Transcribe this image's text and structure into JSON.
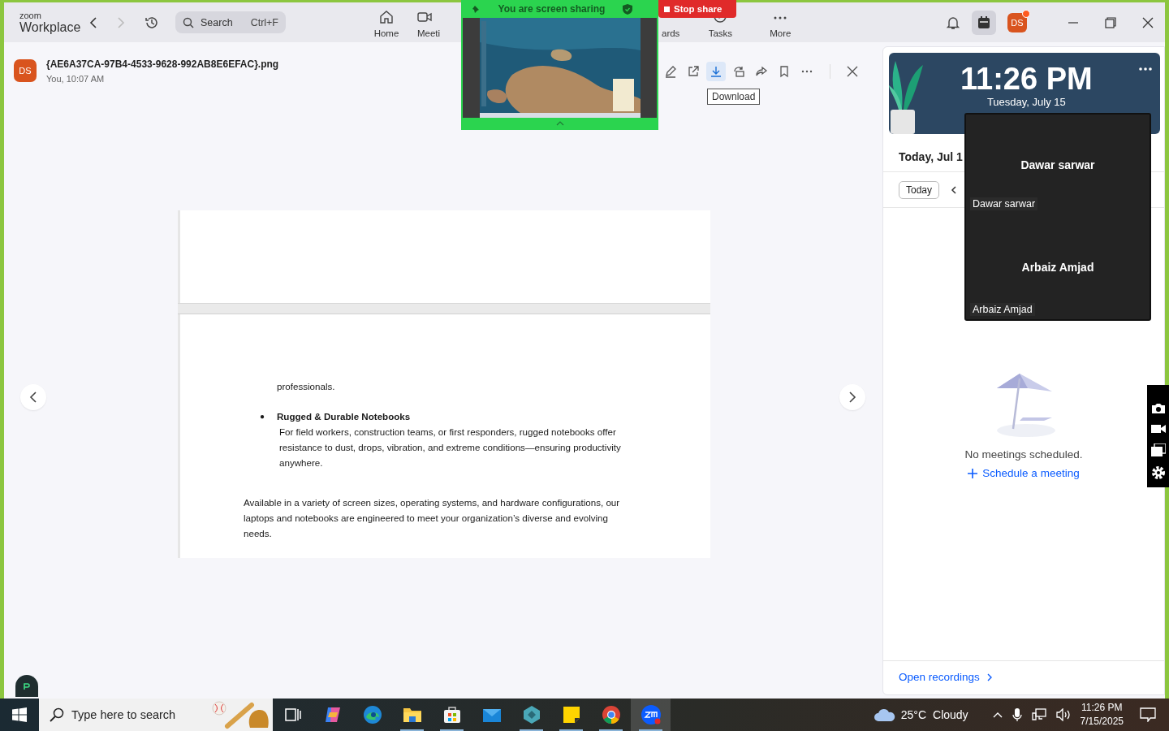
{
  "app": {
    "logo_top": "zoom",
    "logo_bottom": "Workplace",
    "search": {
      "placeholder": "Search",
      "shortcut": "Ctrl+F"
    },
    "forward_disabled": true,
    "nav": [
      {
        "label": "Home"
      },
      {
        "label": "Meeti"
      },
      {
        "label": "ards"
      },
      {
        "label": "Tasks"
      },
      {
        "label": "More"
      }
    ],
    "calendar_button": {
      "selected": true
    },
    "avatar": "DS",
    "avatar_notification": true
  },
  "viewer": {
    "avatar": "DS",
    "file_name": "{AE6A37CA-97B4-4533-9628-992AB8E6EFAC}.png",
    "meta": "You, 10:07 AM",
    "toolbar": [
      {
        "selected": false
      },
      {
        "selected": false
      },
      {
        "selected": true
      },
      {
        "selected": false
      },
      {
        "selected": false
      },
      {
        "selected": false
      },
      {
        "selected": false
      }
    ],
    "tooltip": "Download",
    "document": {
      "continuation": "professionals.",
      "bullet": "●",
      "heading": "Rugged & Durable Notebooks",
      "description": "For field workers, construction teams, or first responders, rugged notebooks offer resistance to dust, drops, vibration, and extreme conditions—ensuring productivity anywhere.",
      "paragraph": "Available in a variety of screen sizes, operating systems, and hardware configurations, our laptops and notebooks are engineered to meet your organization’s diverse and evolving needs."
    }
  },
  "calendar": {
    "time": "11:26 PM",
    "date": "Tuesday, July 15",
    "heading": "Today, Jul 1",
    "today_button": "Today",
    "empty_text": "No meetings scheduled.",
    "schedule_link": "Schedule a meeting",
    "recordings_link": "Open recordings"
  },
  "screen_share": {
    "status": "You are screen sharing",
    "stop_button": "Stop share"
  },
  "participants": [
    {
      "name": "Dawar sarwar",
      "label": "Dawar sarwar"
    },
    {
      "name": "Arbaiz Amjad",
      "label": "Arbaiz Amjad"
    }
  ],
  "taskbar": {
    "search_placeholder": "Type here to search",
    "apps": [
      {
        "running": false,
        "selected": false
      },
      {
        "running": false,
        "selected": false
      },
      {
        "running": false,
        "selected": false
      },
      {
        "running": true,
        "selected": false
      },
      {
        "running": true,
        "selected": false
      },
      {
        "running": false,
        "selected": false
      },
      {
        "running": true,
        "selected": false
      },
      {
        "running": true,
        "selected": false
      },
      {
        "running": true,
        "selected": false
      },
      {
        "running": true,
        "selected": true
      }
    ],
    "temperature": "25°C",
    "weather": "Cloudy",
    "time": "11:26 PM",
    "date": "7/15/2025"
  }
}
